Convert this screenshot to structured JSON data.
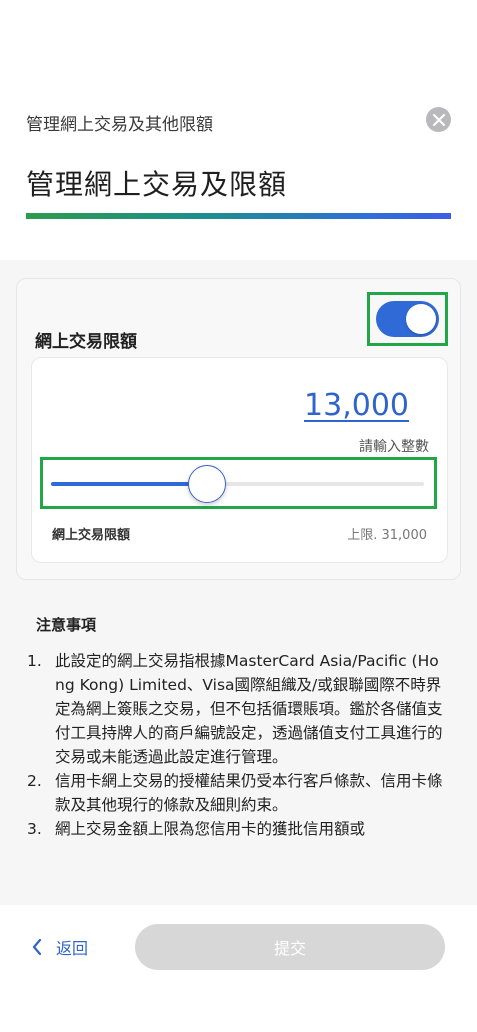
{
  "header": {
    "small_title": "管理網上交易及其他限額",
    "big_title": "管理網上交易及限額"
  },
  "card": {
    "title": "網上交易限額",
    "toggle_on": true,
    "amount": "13,000",
    "hint": "請輸入整數",
    "slider_value": 13000,
    "slider_max": 31000,
    "limit_label": "網上交易限額",
    "limit_max_text": "上限. 31,000"
  },
  "notes": {
    "title": "注意事項",
    "items": [
      {
        "num": "1.",
        "text": "此設定的網上交易指根據MasterCard Asia/Pacific (Hong Kong) Limited、Visa國際組織及/或銀聯國際不時界定為網上簽賬之交易，但不包括循環賬項。鑑於各儲值支付工具持牌人的商戶編號設定，透過儲值支付工具進行的交易或未能透過此設定進行管理。"
      },
      {
        "num": "2.",
        "text": "信用卡網上交易的授權結果仍受本行客戶條款、信用卡條款及其他現行的條款及細則約束。"
      },
      {
        "num": "3.",
        "text": "網上交易金額上限為您信用卡的獲批信用額或"
      }
    ]
  },
  "footer": {
    "back_label": "返回",
    "submit_label": "提交"
  },
  "colors": {
    "accent": "#2f6ad6",
    "highlight": "#22a748",
    "disabled": "#d7d7d7"
  }
}
